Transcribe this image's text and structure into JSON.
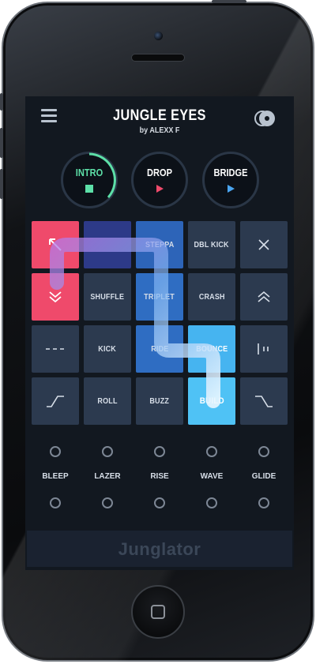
{
  "app": {
    "song_title": "JUNGLE EYES",
    "artist": "by ALEXX F",
    "brand": "Junglator"
  },
  "sections": [
    {
      "label": "INTRO",
      "icon": "stop-square-icon",
      "color": "#5de0a8",
      "active": true
    },
    {
      "label": "DROP",
      "icon": "play-triangle-icon",
      "color": "#ef4a6b",
      "active": false
    },
    {
      "label": "BRIDGE",
      "icon": "play-triangle-icon",
      "color": "#4aa5f0",
      "active": false
    }
  ],
  "pads": {
    "row1": {
      "c2": "",
      "c3": "STEPPA",
      "c4": "DBL KICK"
    },
    "row2": {
      "c2": "SHUFFLE",
      "c3": "TRIPLET",
      "c4": "CRASH"
    },
    "row3": {
      "c2": "KICK",
      "c3": "RIDE",
      "c4": "BOUNCE"
    },
    "row4": {
      "c2": "ROLL",
      "c3": "BUZZ",
      "c4": "BUILD"
    }
  },
  "fx": [
    "BLEEP",
    "LAZER",
    "RISE",
    "WAVE",
    "GLIDE"
  ],
  "colors": {
    "accent_pink": "#ef4a6b",
    "accent_cyan": "#46b4f0",
    "accent_green": "#5de0a8",
    "pad_default": "#2c3a4f",
    "screen_bg": "#121820"
  }
}
